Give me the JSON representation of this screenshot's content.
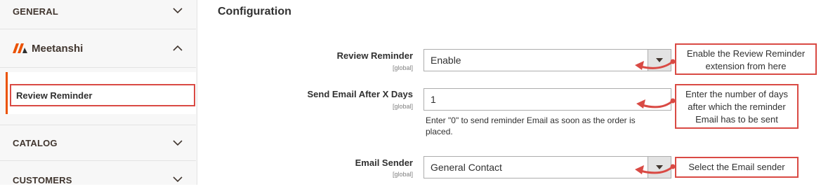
{
  "sidebar": {
    "general": "GENERAL",
    "brand": "Meetanshi",
    "review_reminder": "Review Reminder",
    "catalog": "CATALOG",
    "customers": "CUSTOMERS"
  },
  "main": {
    "title": "Configuration",
    "fields": [
      {
        "label": "Review Reminder",
        "scope": "[global]",
        "value": "Enable"
      },
      {
        "label": "Send Email After X Days",
        "scope": "[global]",
        "value": "1",
        "hint": "Enter \"0\" to send reminder Email as soon as the order is placed."
      },
      {
        "label": "Email Sender",
        "scope": "[global]",
        "value": "General Contact"
      }
    ]
  },
  "callouts": {
    "c1": "Enable the Review Reminder extension from here",
    "c2": "Enter the number of days after which the reminder Email has to be sent",
    "c3": "Select the Email sender"
  },
  "colors": {
    "accent": "#eb5202",
    "annotation": "#d94a44"
  }
}
